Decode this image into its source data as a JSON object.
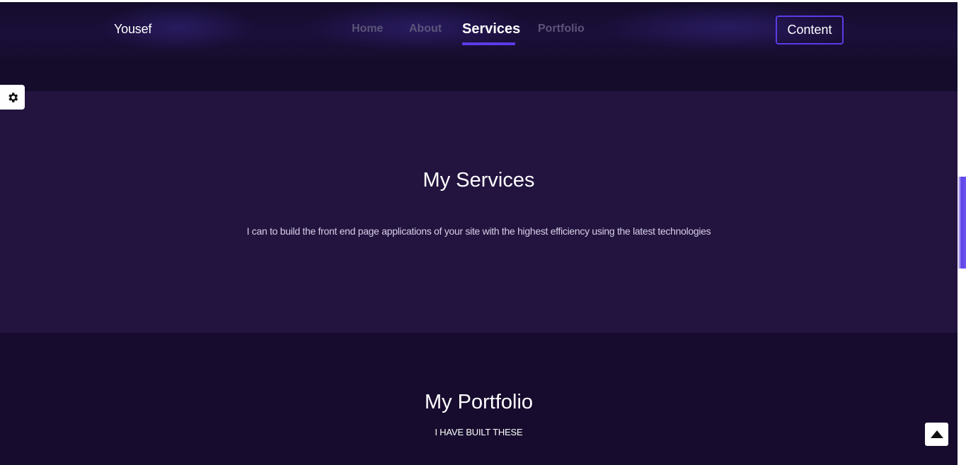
{
  "brand": "Yousef",
  "nav": {
    "items": [
      {
        "label": "Home"
      },
      {
        "label": "About"
      },
      {
        "label": "Services"
      },
      {
        "label": "Portfolio"
      }
    ],
    "active": "Services",
    "cta_label": "Content"
  },
  "services": {
    "title": "My Services",
    "description": "I can to build the front end page applications of your site with the highest efficiency using the latest technologies"
  },
  "portfolio": {
    "title": "My Portfolio",
    "subtitle": "I HAVE BUILT THESE"
  },
  "icons": {
    "settings": "gear-icon",
    "back_to_top": "caret-up-icon"
  },
  "colors": {
    "accent": "#5b3be6",
    "header_bg": "#1a0f3a",
    "services_bg": "#22133f",
    "portfolio_bg": "#170c2e"
  }
}
